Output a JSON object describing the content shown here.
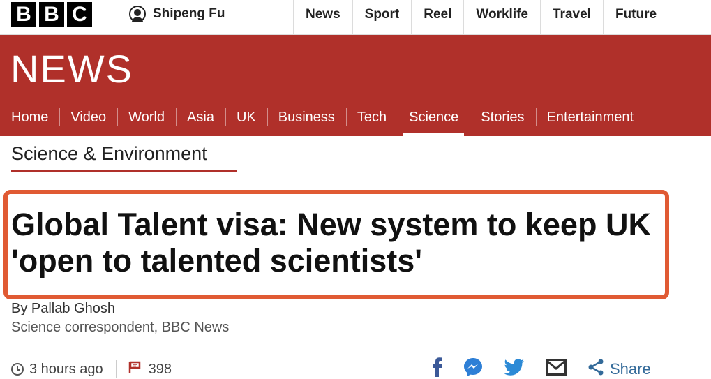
{
  "global_header": {
    "logo_letters": [
      "B",
      "B",
      "C"
    ],
    "account_name": "Shipeng Fu",
    "nav_items": [
      "News",
      "Sport",
      "Reel",
      "Worklife",
      "Travel",
      "Future"
    ]
  },
  "masthead": {
    "title": "NEWS",
    "nav_items": [
      "Home",
      "Video",
      "World",
      "Asia",
      "UK",
      "Business",
      "Tech",
      "Science",
      "Stories",
      "Entertainment"
    ],
    "active_item": "Science",
    "background_color": "#b0302a"
  },
  "article": {
    "section": "Science & Environment",
    "headline": "Global Talent visa: New system to keep UK 'open to talented scientists'",
    "author": "By Pallab Ghosh",
    "author_role": "Science correspondent, BBC News",
    "time_ago": "3 hours ago",
    "comment_count": "398",
    "highlight_color": "#e05a33"
  },
  "share": {
    "icons": [
      "facebook-icon",
      "messenger-icon",
      "twitter-icon",
      "email-icon",
      "share-icon"
    ],
    "label": "Share"
  }
}
